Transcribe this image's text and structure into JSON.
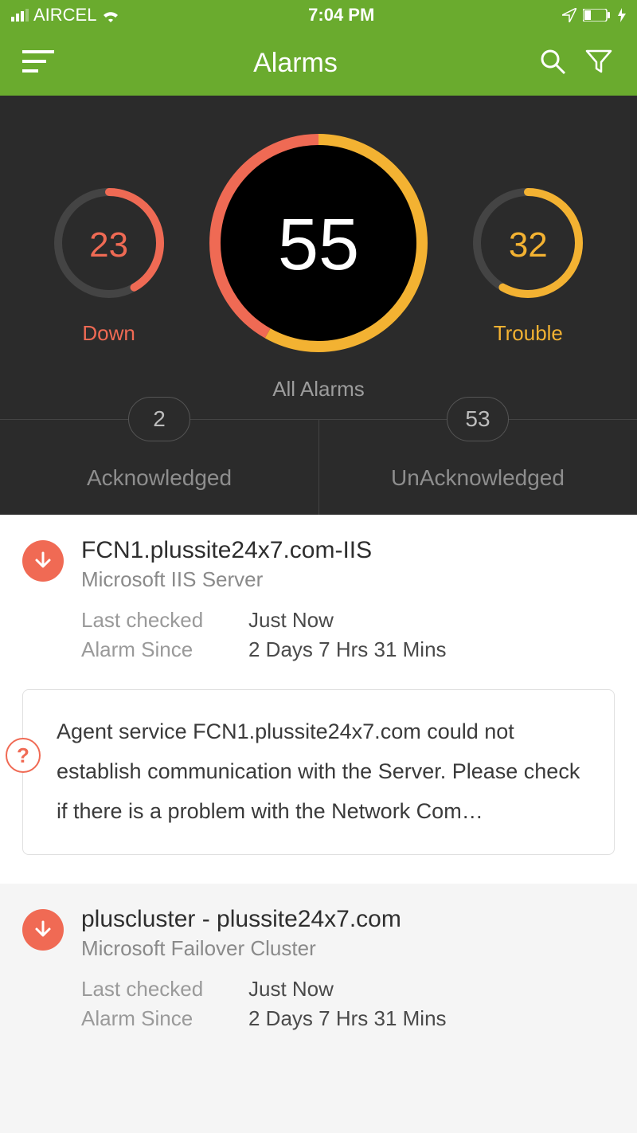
{
  "status_bar": {
    "carrier": "AIRCEL",
    "time": "7:04 PM"
  },
  "header": {
    "title": "Alarms"
  },
  "colors": {
    "accent_green": "#6aab2e",
    "down_red": "#ef6a54",
    "trouble_yellow": "#f3b232",
    "dark_bg": "#2b2b2b"
  },
  "dashboard": {
    "down": {
      "value": "23",
      "label": "Down"
    },
    "all": {
      "value": "55",
      "label": "All Alarms"
    },
    "trouble": {
      "value": "32",
      "label": "Trouble"
    },
    "acknowledged": {
      "value": "2",
      "label": "Acknowledged"
    },
    "unacknowledged": {
      "value": "53",
      "label": "UnAcknowledged"
    }
  },
  "labels": {
    "last_checked": "Last checked",
    "alarm_since": "Alarm Since"
  },
  "alarms": [
    {
      "status": "down",
      "title": "FCN1.plussite24x7.com-IIS",
      "subtitle": "Microsoft IIS Server",
      "last_checked": "Just Now",
      "alarm_since": "2 Days 7 Hrs 31 Mins",
      "note": "Agent service FCN1.plussite24x7.com could not establish communication with the Server. Please check if there is a problem with the Network Com…"
    },
    {
      "status": "down",
      "title": "pluscluster - plussite24x7.com",
      "subtitle": "Microsoft Failover Cluster",
      "last_checked": "Just Now",
      "alarm_since": "2 Days 7 Hrs 31 Mins"
    }
  ],
  "chart_data": [
    {
      "type": "pie",
      "title": "Down",
      "values": [
        23,
        32
      ],
      "total": 55,
      "display_value": 23,
      "note": "ring gauge; filled arc ≈ 23/55 in red, remainder dark"
    },
    {
      "type": "pie",
      "title": "All Alarms",
      "categories": [
        "Down",
        "Trouble"
      ],
      "values": [
        23,
        32
      ],
      "total": 55,
      "display_value": 55,
      "note": "ring gauge; red arc ≈ 23/55, yellow arc ≈ 32/55"
    },
    {
      "type": "pie",
      "title": "Trouble",
      "values": [
        32,
        23
      ],
      "total": 55,
      "display_value": 32,
      "note": "ring gauge; filled arc ≈ 32/55 in yellow, remainder dark"
    }
  ]
}
